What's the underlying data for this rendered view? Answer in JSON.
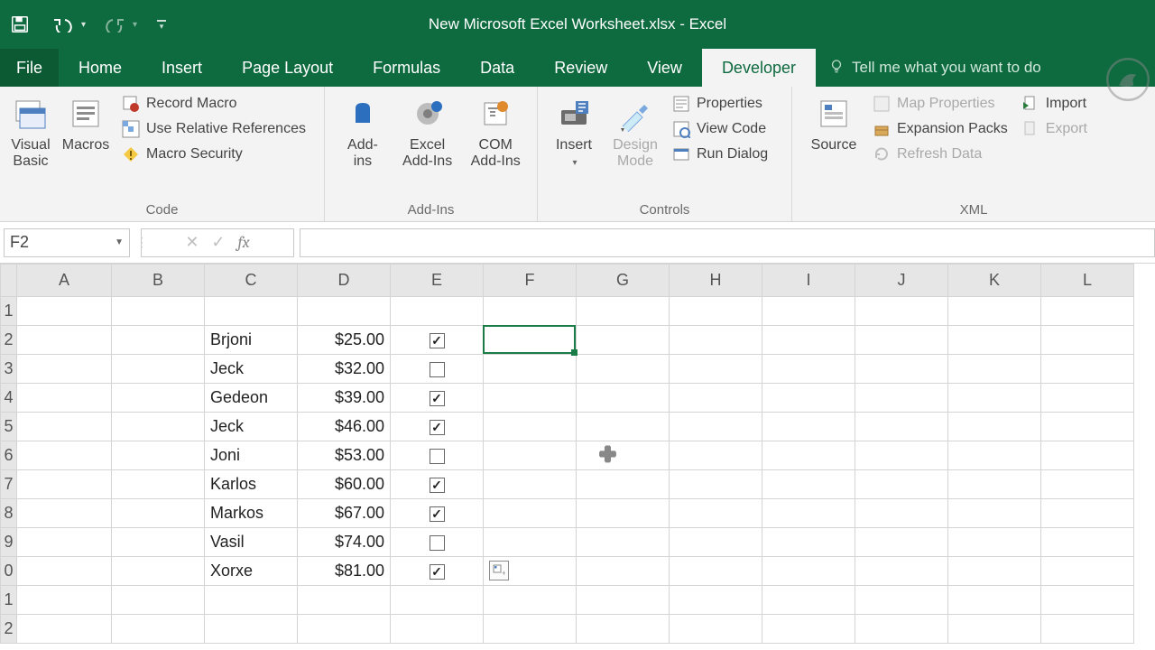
{
  "title": "New Microsoft Excel Worksheet.xlsx - Excel",
  "tabs": {
    "file": "File",
    "home": "Home",
    "insert": "Insert",
    "page_layout": "Page Layout",
    "formulas": "Formulas",
    "data": "Data",
    "review": "Review",
    "view": "View",
    "developer": "Developer",
    "tellme_placeholder": "Tell me what you want to do"
  },
  "ribbon": {
    "code": {
      "visual_basic": "Visual\nBasic",
      "macros": "Macros",
      "record_macro": "Record Macro",
      "use_relative": "Use Relative References",
      "macro_security": "Macro Security",
      "label": "Code"
    },
    "addins": {
      "addins": "Add-\nins",
      "excel_addins": "Excel\nAdd-Ins",
      "com_addins": "COM\nAdd-Ins",
      "label": "Add-Ins"
    },
    "controls": {
      "insert": "Insert",
      "design_mode": "Design\nMode",
      "properties": "Properties",
      "view_code": "View Code",
      "run_dialog": "Run Dialog",
      "label": "Controls"
    },
    "xml": {
      "source": "Source",
      "map_properties": "Map Properties",
      "expansion_packs": "Expansion Packs",
      "refresh_data": "Refresh Data",
      "import": "Import",
      "export": "Export",
      "label": "XML"
    }
  },
  "formula_bar": {
    "name_box": "F2",
    "cancel": "✕",
    "enter": "✓",
    "fx": "fx",
    "formula": ""
  },
  "columns": [
    "A",
    "B",
    "C",
    "D",
    "E",
    "F",
    "G",
    "H",
    "I",
    "J",
    "K",
    "L"
  ],
  "row_headers": [
    "1",
    "2",
    "3",
    "4",
    "5",
    "6",
    "7",
    "8",
    "9",
    "0",
    "1",
    "2"
  ],
  "sheet": {
    "rows": [
      {
        "name": "Brjoni",
        "amount": "$25.00",
        "checked": true
      },
      {
        "name": "Jeck",
        "amount": "$32.00",
        "checked": false
      },
      {
        "name": "Gedeon",
        "amount": "$39.00",
        "checked": true
      },
      {
        "name": "Jeck",
        "amount": "$46.00",
        "checked": true
      },
      {
        "name": "Joni",
        "amount": "$53.00",
        "checked": false
      },
      {
        "name": "Karlos",
        "amount": "$60.00",
        "checked": true
      },
      {
        "name": "Markos",
        "amount": "$67.00",
        "checked": true
      },
      {
        "name": "Vasil",
        "amount": "$74.00",
        "checked": false
      },
      {
        "name": "Xorxe",
        "amount": "$81.00",
        "checked": true
      }
    ]
  },
  "active_cell": "F2"
}
